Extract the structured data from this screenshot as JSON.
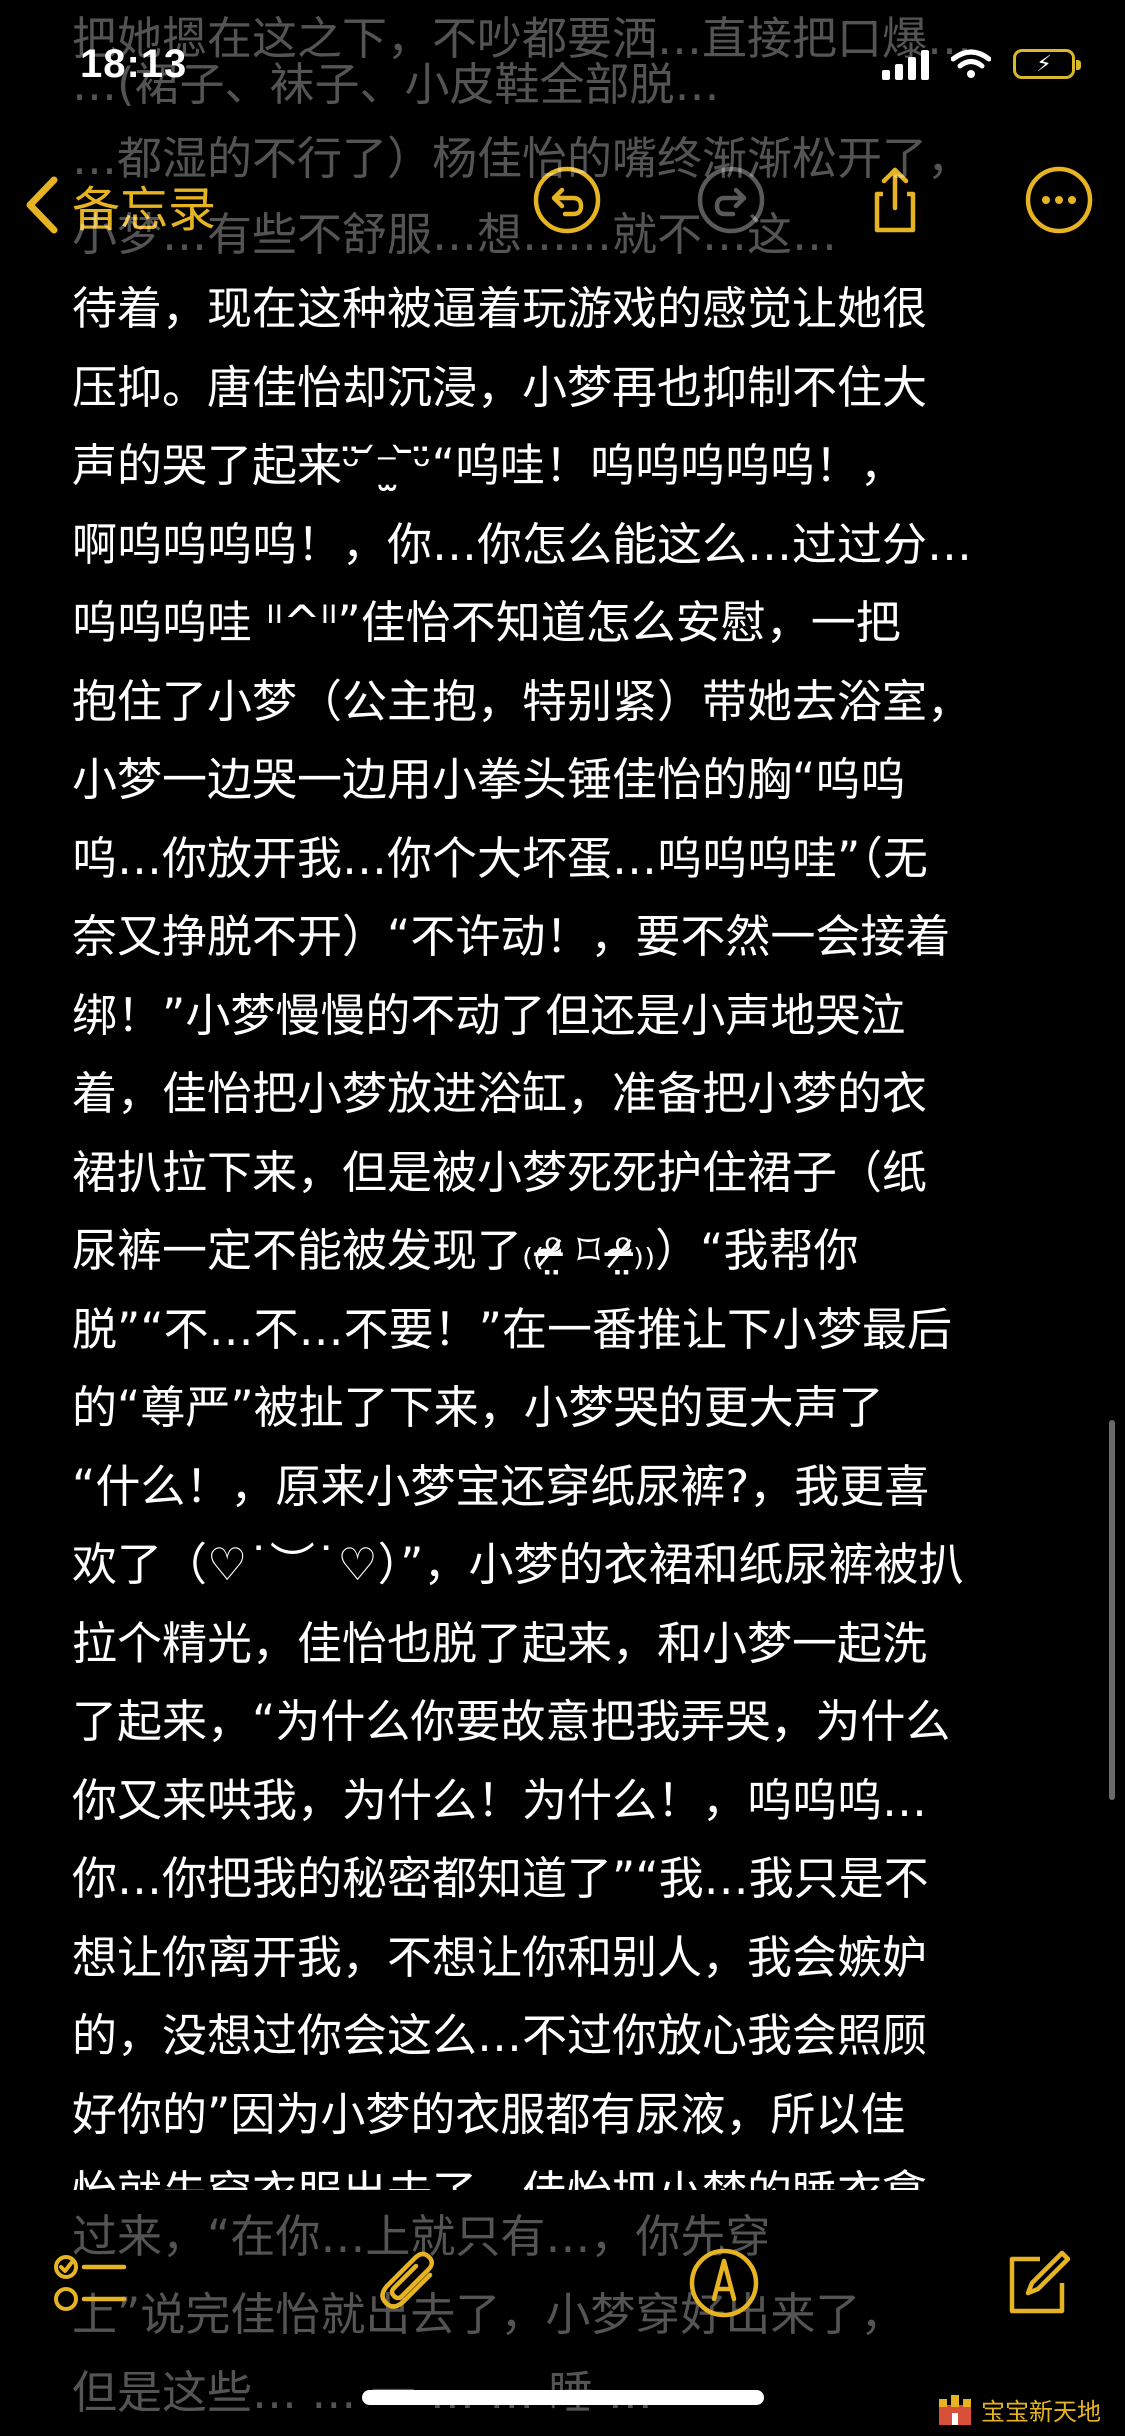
{
  "status_bar": {
    "time": "18:13"
  },
  "nav": {
    "back_label": "备忘录"
  },
  "accent_color": "#E6B422",
  "icons": [
    "chevron-left-icon",
    "undo-icon",
    "redo-icon",
    "share-icon",
    "more-icon",
    "checklist-icon",
    "attachment-icon",
    "markup-icon",
    "compose-icon"
  ],
  "note": {
    "top_ghost": [
      "把她摁在这之下，不吵都要洒…直接把口爆…",
      "…(裙子、袜子、小皮鞋全部脱…",
      "…都湿的不行了）杨佳怡的嘴终渐渐松开了，",
      "小梦…有些不舒服…想……就不…这…"
    ],
    "lines": [
      "待着，现在这种被逼着玩游戏的感觉让她很",
      "压抑。唐佳怡却沉浸，小梦再也抑制不住大",
      "声的哭了起来ᵕ̈ ᷄⁻̫ ᷅ᵕ̈“呜哇！呜呜呜呜呜！，",
      "啊呜呜呜呜！，你…你怎么能这么…过过分…",
      "呜呜呜哇 ᴵᴵ^ᴵᴵ”佳怡不知道怎么安慰，一把",
      "抱住了小梦（公主抱，特别紧）带她去浴室，",
      "小梦一边哭一边用小拳头锤佳怡的胸“呜呜",
      "呜…你放开我…你个大坏蛋…呜呜呜哇”（无",
      "奈又挣脱不开）“不许动！，要不然一会接着",
      "绑！”小梦慢慢的不动了但还是小声地哭泣",
      "着，佳怡把小梦放进浴缸，准备把小梦的衣",
      "裙扒拉下来，但是被小梦死死护住裙子（纸",
      "尿裤一定不能被发现了₍₍ᵒ̴̶̷̤ ⌑ ᵒ̴̶̷̤₎₎）“我帮你",
      "脱”“不…不…不要！”在一番推让下小梦最后",
      "的“尊严”被扯了下来，小梦哭的更大声了",
      "“什么！，原来小梦宝还穿纸尿裤?，我更喜",
      "欢了（♡˙︶˙♡）”，小梦的衣裙和纸尿裤被扒",
      "拉个精光，佳怡也脱了起来，和小梦一起洗",
      "了起来，“为什么你要故意把我弄哭，为什么",
      "你又来哄我，为什么！为什么！，呜呜呜…",
      "你…你把我的秘密都知道了”“我…我只是不",
      "想让你离开我，不想让你和别人，我会嫉妒",
      "的，没想过你会这么…不过你放心我会照顾",
      "好你的”因为小梦的衣服都有尿液，所以佳",
      "怡就先穿衣服出去了，佳怡把小梦的睡衣拿"
    ],
    "bottom_ghost": [
      "过来，“在你…上就只有…，你先穿",
      "上”说完佳怡就出去了，小梦穿好出来了，",
      "但是这些… … 一 … … 睡 …"
    ]
  },
  "watermark": {
    "text": "宝宝新天地"
  }
}
